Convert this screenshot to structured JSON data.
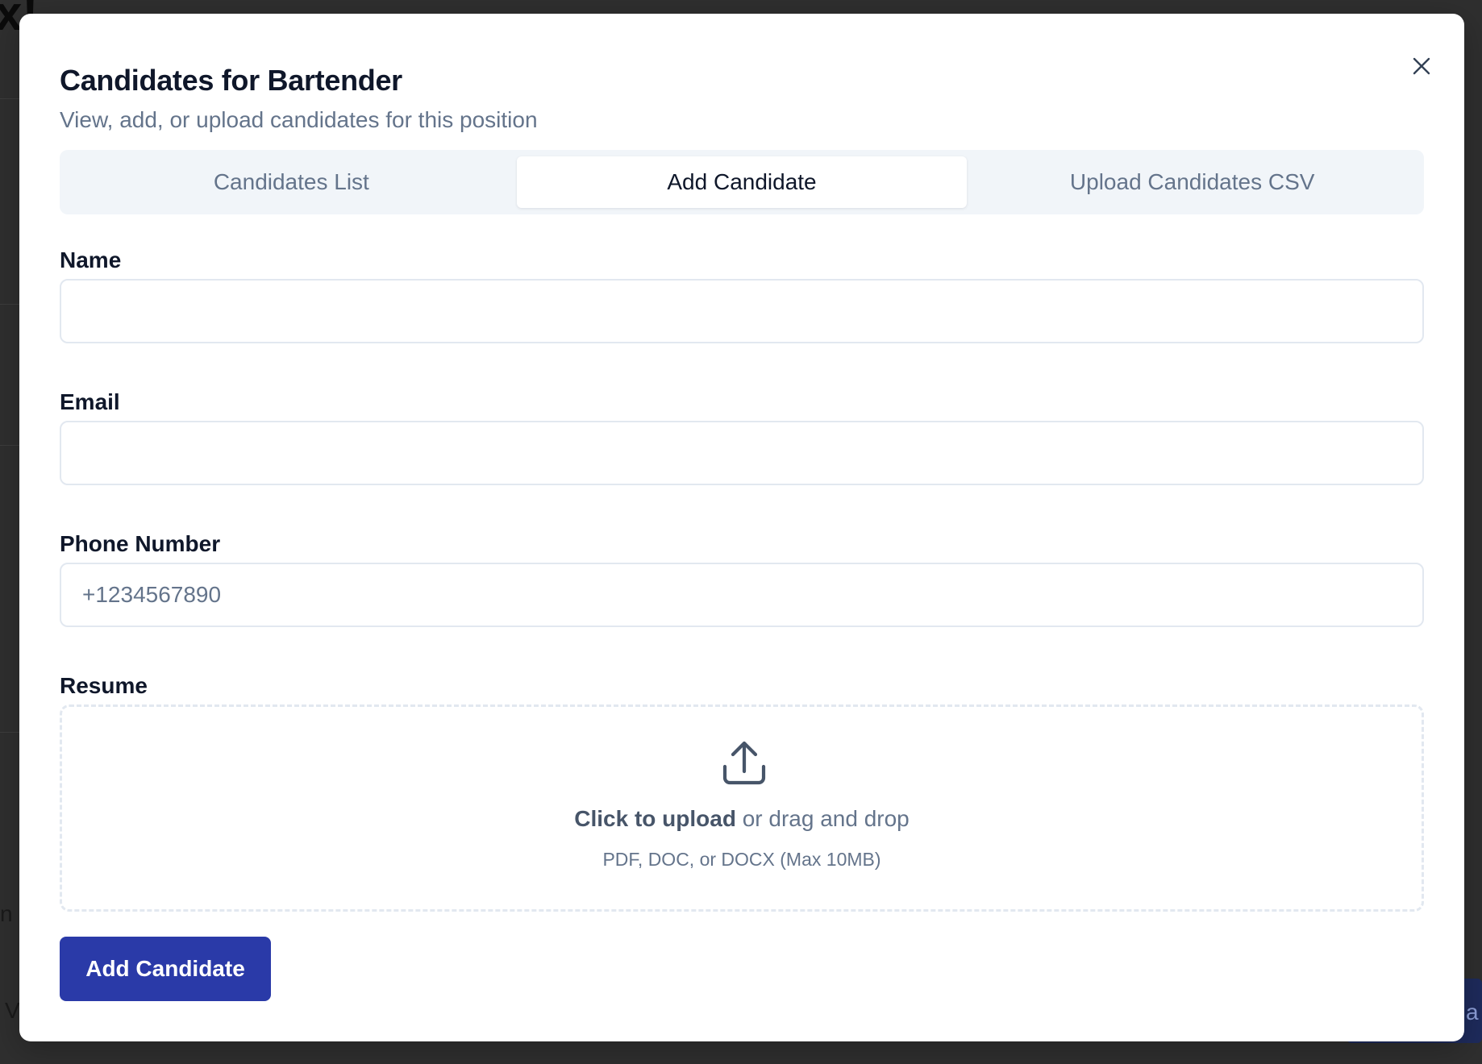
{
  "background": {
    "fragment_top": "x!",
    "fragment_left": "n",
    "fragment_bottom": "V",
    "fragment_right": "a"
  },
  "dialog": {
    "title": "Candidates for Bartender",
    "subtitle": "View, add, or upload candidates for this position",
    "close_icon": "close-icon"
  },
  "tabs": [
    {
      "label": "Candidates List",
      "active": false
    },
    {
      "label": "Add Candidate",
      "active": true
    },
    {
      "label": "Upload Candidates CSV",
      "active": false
    }
  ],
  "form": {
    "name": {
      "label": "Name",
      "value": "",
      "placeholder": ""
    },
    "email": {
      "label": "Email",
      "value": "",
      "placeholder": ""
    },
    "phone": {
      "label": "Phone Number",
      "value": "",
      "placeholder": "+1234567890"
    },
    "resume": {
      "label": "Resume",
      "icon": "upload-icon",
      "click_text": "Click to upload",
      "drag_text": " or drag and drop",
      "hint": "PDF, DOC, or DOCX (Max 10MB)"
    },
    "submit_label": "Add Candidate"
  },
  "colors": {
    "primary_button": "#2a3aa8",
    "tab_background": "#f1f5f9",
    "muted_text": "#64748b",
    "border": "#e2e8f0"
  }
}
